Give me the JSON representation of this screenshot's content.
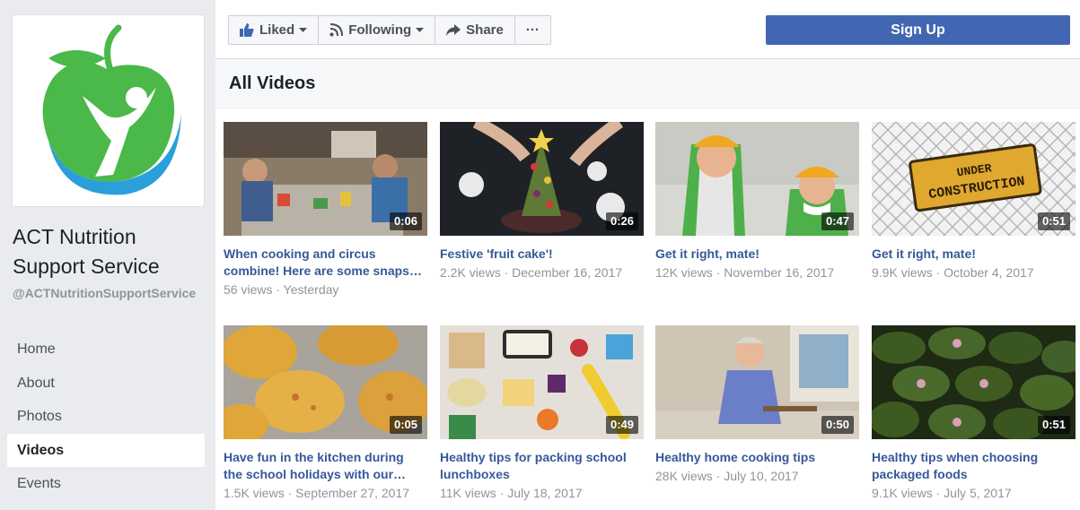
{
  "page": {
    "name": "ACT Nutrition Support Service",
    "name_line1": "ACT Nutrition",
    "name_line2": "Support Service",
    "handle": "@ACTNutritionSupportService"
  },
  "nav": [
    {
      "label": "Home"
    },
    {
      "label": "About"
    },
    {
      "label": "Photos"
    },
    {
      "label": "Videos",
      "active": true
    },
    {
      "label": "Events"
    }
  ],
  "actions": {
    "liked": "Liked",
    "following": "Following",
    "share": "Share",
    "more": "···",
    "signup": "Sign Up"
  },
  "section_title": "All Videos",
  "colors": {
    "brand_blue": "#4267b2",
    "link_blue": "#365899",
    "meta_grey": "#90949c",
    "logo_green": "#4bb84a",
    "logo_blue": "#2b9fd9"
  },
  "videos": [
    {
      "title1": "When cooking and circus",
      "title2": "combine! Here are some snaps…",
      "views": "56 views",
      "date": "Yesterday",
      "duration": "0:06"
    },
    {
      "title1": "Festive 'fruit cake'!",
      "title2": "",
      "views": "2.2K views",
      "date": "December 16, 2017",
      "duration": "0:26"
    },
    {
      "title1": "Get it right, mate!",
      "title2": "",
      "views": "12K views",
      "date": "November 16, 2017",
      "duration": "0:47"
    },
    {
      "title1": "Get it right, mate!",
      "title2": "",
      "views": "9.9K views",
      "date": "October 4, 2017",
      "duration": "0:51",
      "sign_line1": "UNDER",
      "sign_line2": "CONSTRUCTION"
    },
    {
      "title1": "Have fun in the kitchen during",
      "title2": "the school holidays with our…",
      "views": "1.5K views",
      "date": "September 27, 2017",
      "duration": "0:05"
    },
    {
      "title1": "Healthy tips for packing school",
      "title2": "lunchboxes",
      "views": "11K views",
      "date": "July 18, 2017",
      "duration": "0:49"
    },
    {
      "title1": "Healthy home cooking tips",
      "title2": "",
      "views": "28K views",
      "date": "July 10, 2017",
      "duration": "0:50"
    },
    {
      "title1": "Healthy tips when choosing",
      "title2": "packaged foods",
      "views": "9.1K views",
      "date": "July 5, 2017",
      "duration": "0:51"
    }
  ]
}
